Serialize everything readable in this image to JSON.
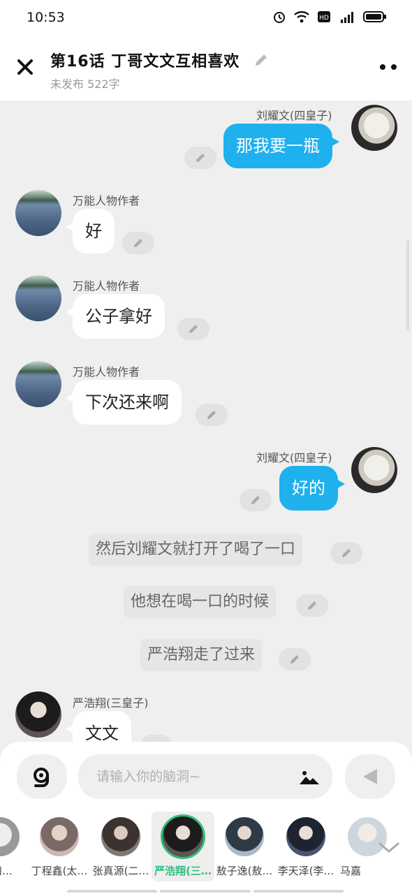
{
  "status": {
    "time": "10:53"
  },
  "header": {
    "title": "第16话  丁哥文文互相喜欢",
    "subtitle": "未发布 522字"
  },
  "messages": {
    "m1": {
      "name": "刘耀文(四皇子)",
      "text": "那我要一瓶"
    },
    "m2": {
      "name": "万能人物作者",
      "text": "好"
    },
    "m3": {
      "name": "万能人物作者",
      "text": "公子拿好"
    },
    "m4": {
      "name": "万能人物作者",
      "text": "下次还来啊"
    },
    "m5": {
      "name": "刘耀文(四皇子)",
      "text": "好的"
    },
    "n1": {
      "text": "然后刘耀文就打开了喝了一口"
    },
    "n2": {
      "text": "他想在喝一口的时候"
    },
    "n3": {
      "text": "严浩翔走了过来"
    },
    "m6": {
      "name": "严浩翔(三皇子)",
      "text": "文文"
    }
  },
  "composer": {
    "placeholder": "请输入你的脑洞~"
  },
  "characters": [
    {
      "label": "(四…"
    },
    {
      "label": "丁程鑫(太…"
    },
    {
      "label": "张真源(二…"
    },
    {
      "label": "严浩翔(三…"
    },
    {
      "label": "敖子逸(敖…"
    },
    {
      "label": "李天泽(李…"
    },
    {
      "label": "马嘉"
    }
  ],
  "colors": {
    "accent_blue": "#1fb0ee",
    "active_green": "#2fbf7d"
  },
  "icons": [
    "alarm-icon",
    "wifi-icon",
    "hd-icon",
    "signal-4g-icon",
    "battery-icon",
    "close-icon",
    "pencil-icon",
    "more-icon",
    "ai-icon",
    "image-icon",
    "send-icon",
    "chevron-down-icon"
  ]
}
